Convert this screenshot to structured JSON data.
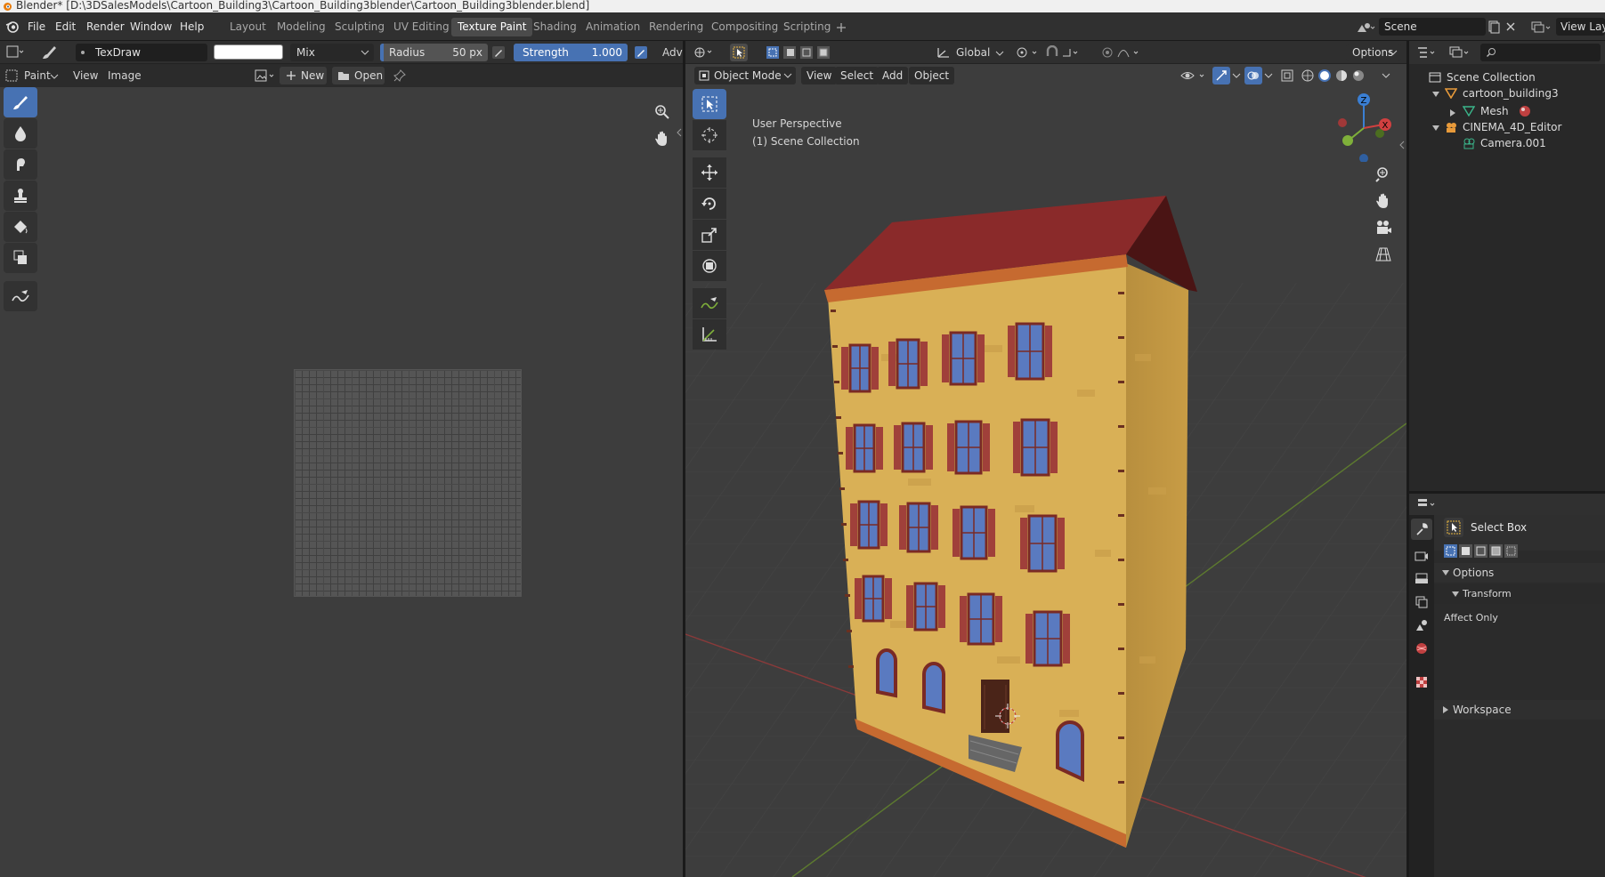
{
  "window_title": "Blender* [D:\\3DSalesModels\\Cartoon_Building3\\Cartoon_Building3blender\\Cartoon_Building3blender.blend]",
  "menus": [
    "File",
    "Edit",
    "Render",
    "Window",
    "Help"
  ],
  "workspaces": [
    "Layout",
    "Modeling",
    "Sculpting",
    "UV Editing",
    "Texture Paint",
    "Shading",
    "Animation",
    "Rendering",
    "Compositing",
    "Scripting"
  ],
  "active_workspace": "Texture Paint",
  "scene_name": "Scene",
  "view_layer": "View Layer",
  "tool_header": {
    "brush_name": "TexDraw",
    "blend_mode": "Mix",
    "radius_label": "Radius",
    "radius_value": "50 px",
    "strength_label": "Strength",
    "strength_value": "1.000",
    "strength_fraction": 1.0,
    "advanced_label": "Adva",
    "color": "#ffffff"
  },
  "image_editor": {
    "mode": "Paint",
    "view": "View",
    "image": "Image",
    "new": "New",
    "open": "Open"
  },
  "viewport": {
    "orientation": "Global",
    "options": "Options",
    "mode": "Object Mode",
    "menus": [
      "View",
      "Select",
      "Add",
      "Object"
    ],
    "perspective": "User Perspective",
    "collection": "(1) Scene Collection"
  },
  "outliner": {
    "items": [
      {
        "label": "Scene Collection",
        "icon": "collection-icon"
      },
      {
        "label": "cartoon_building3",
        "icon": "mesh-object-icon"
      },
      {
        "label": "Mesh",
        "icon": "mesh-data-icon"
      },
      {
        "label": "CINEMA_4D_Editor",
        "icon": "empty-icon"
      },
      {
        "label": "Camera.001",
        "icon": "camera-icon"
      }
    ]
  },
  "properties": {
    "active_tool": "Select Box",
    "options": "Options",
    "transform": "Transform",
    "affect_only": "Affect Only",
    "workspace": "Workspace"
  },
  "colors": {
    "accent": "#4772b3",
    "header": "#303030",
    "viewport_bg": "#3d3d3d",
    "x_axis": "#d04040",
    "y_axis": "#7fb03a",
    "z_axis": "#3a7fd4"
  }
}
